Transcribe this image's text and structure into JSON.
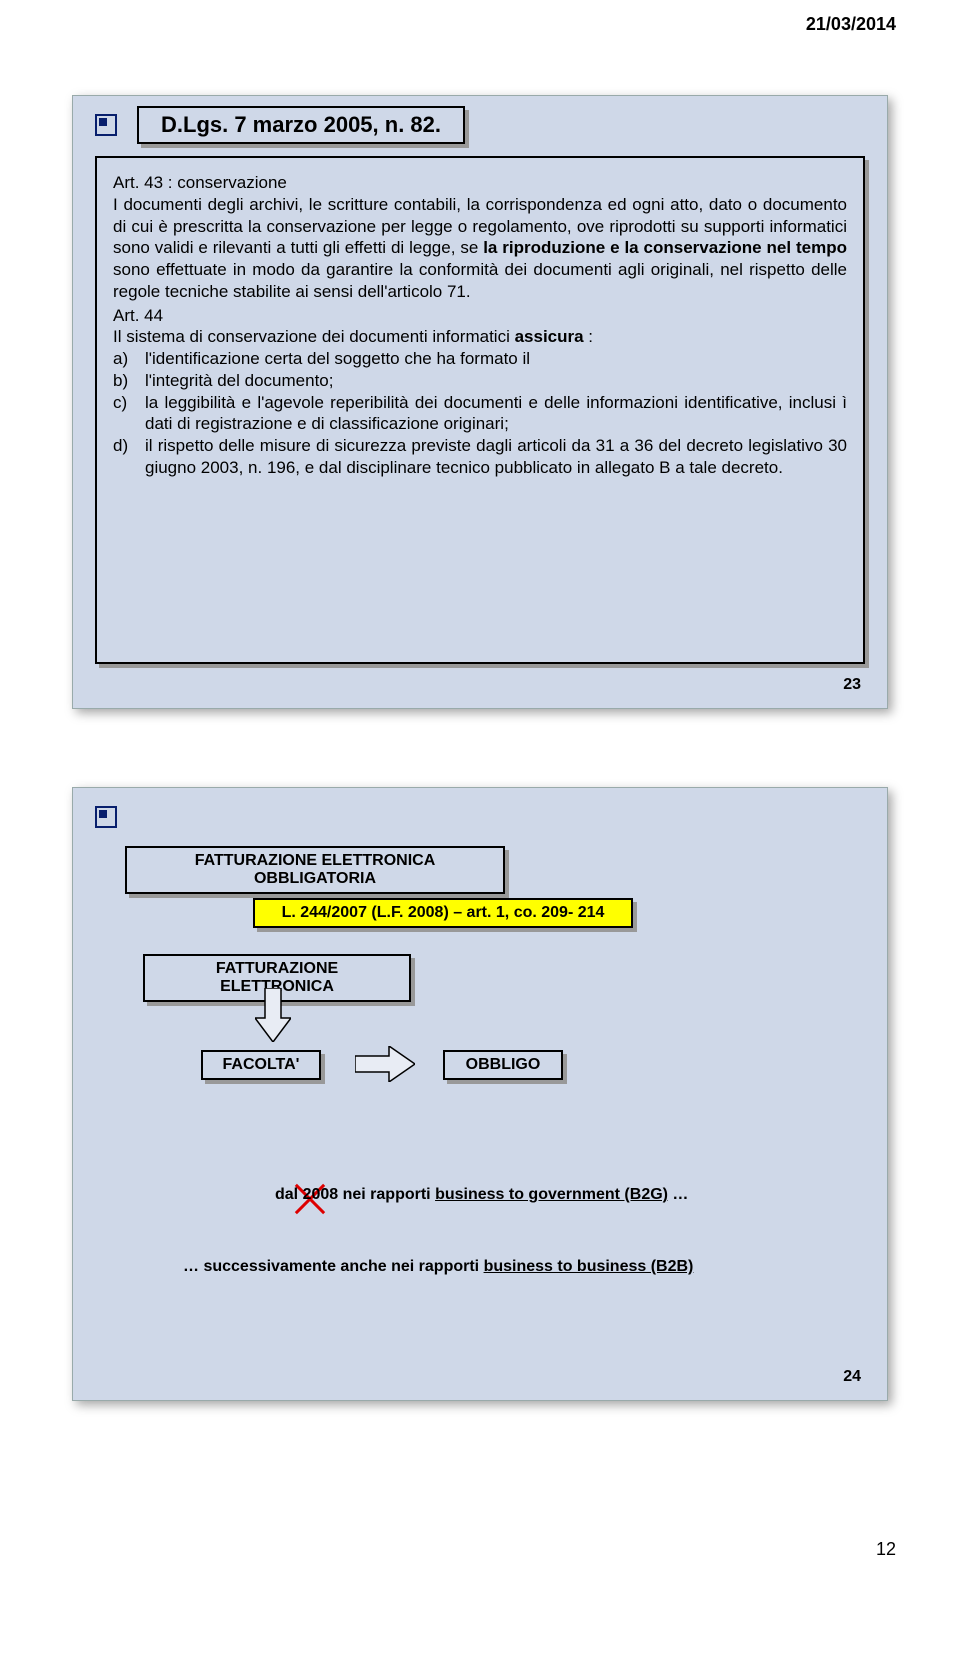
{
  "date": "21/03/2014",
  "slide1": {
    "title": "D.Lgs. 7 marzo 2005, n. 82.",
    "art43_label": "Art. 43 : conservazione",
    "art43_body": "I documenti degli archivi, le scritture contabili, la corrispondenza ed ogni atto, dato o documento di cui è prescritta la conservazione per legge o regolamento, ove riprodotti su supporti informatici sono validi e rilevanti a tutti gli effetti di legge, se la riproduzione e la conservazione nel tempo sono effettuate in modo da garantire la conformità dei documenti agli originali, nel rispetto delle regole tecniche stabilite ai sensi dell'articolo 71.",
    "art44_label": "Art. 44",
    "art44_intro": "Il sistema di conservazione dei documenti informatici assicura :",
    "items": [
      {
        "marker": "a)",
        "text": "l'identificazione certa del soggetto che ha formato il"
      },
      {
        "marker": "b)",
        "text": "l'integrità del documento;"
      },
      {
        "marker": "c)",
        "text": "la leggibilità e l'agevole reperibilità dei documenti e delle informazioni identificative, inclusi ì dati di registrazione e di classificazione originari;"
      },
      {
        "marker": "d)",
        "text": "il rispetto delle misure di sicurezza previste dagli articoli da 31 a 36 del decreto legislativo 30 giugno 2003, n. 196, e dal disciplinare tecnico pubblicato in allegato B a tale decreto."
      }
    ],
    "page": "23"
  },
  "slide2": {
    "header_box": "FATTURAZIONE ELETTRONICA OBBLIGATORIA",
    "law_box": "L. 244/2007 (L.F. 2008) – art. 1, co. 209- 214",
    "sub_box": "FATTURAZIONE ELETTRONICA",
    "left_box": "FACOLTA'",
    "right_box": "OBBLIGO",
    "line1_pre": "dal ",
    "line1_strike": "2008",
    "line1_post": " nei rapporti ",
    "line1_u": "business to government (B2G)",
    "line1_end": " …",
    "line2_pre": "… successivamente anche nei rapporti ",
    "line2_u": "business to business (B2B)",
    "page": "24"
  },
  "footer_page": "12"
}
